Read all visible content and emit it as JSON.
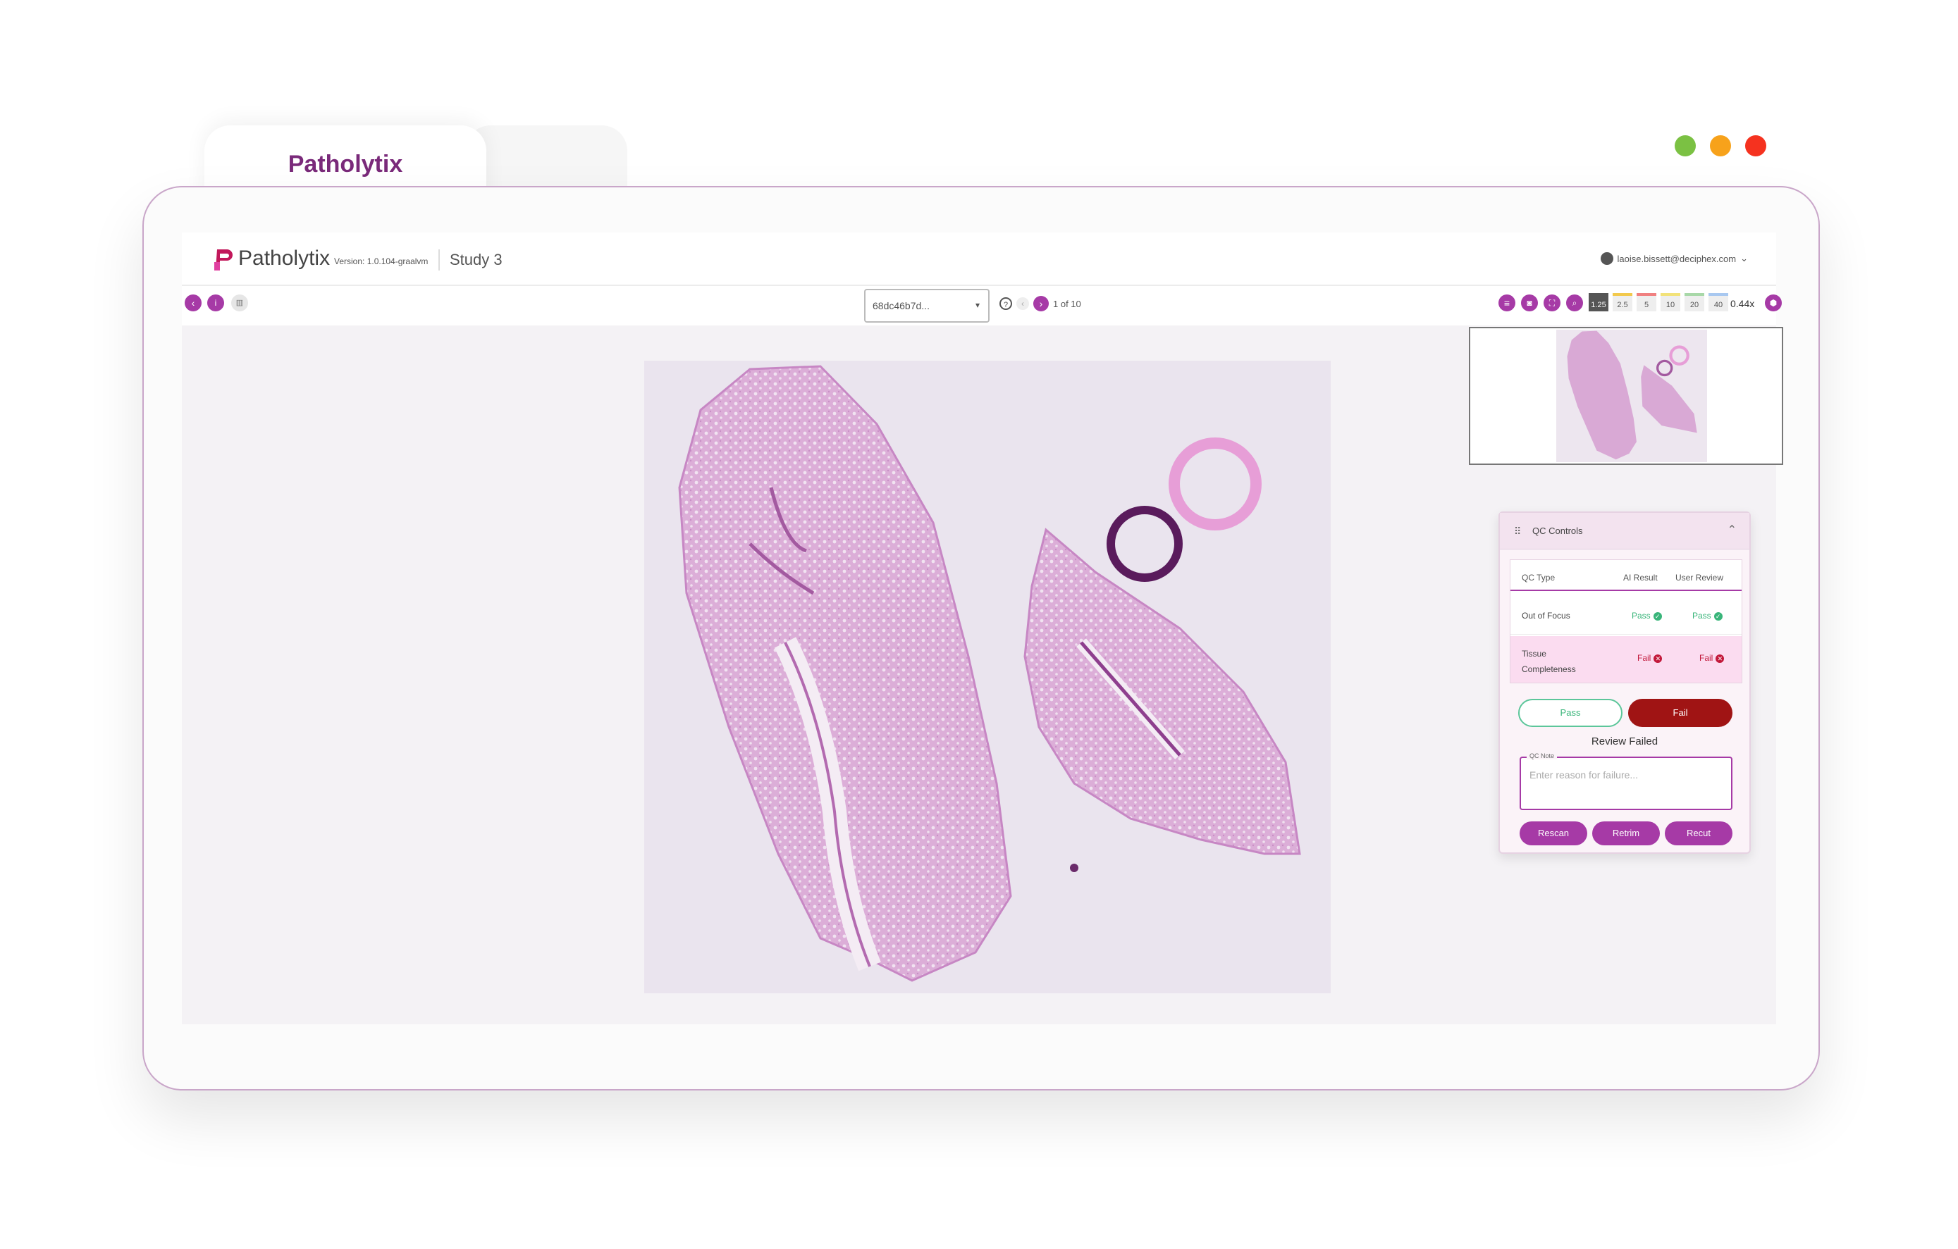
{
  "window": {
    "tab_title": "Patholytix",
    "dots": [
      "#7bc143",
      "#f7a21b",
      "#f5321f"
    ]
  },
  "header": {
    "logo_text": "Patholytix",
    "version": "Version: 1.0.104-graalvm",
    "study": "Study 3",
    "user_email": "laoise.bissett@deciphex.com"
  },
  "toolbar": {
    "slide_select_value": "68dc46b7d...",
    "pager_text": "1 of 10",
    "magnifications": [
      "1.25",
      "2.5",
      "5",
      "10",
      "20",
      "40"
    ],
    "magnification_colors": [
      "#555555",
      "#f2c94c",
      "#f08080",
      "#f2e279",
      "#a8d8a8",
      "#a8c8f0"
    ],
    "active_magnification": "1.25",
    "zoom_value": "0.44x"
  },
  "qc": {
    "title": "QC Controls",
    "columns": [
      "QC Type",
      "AI Result",
      "User Review"
    ],
    "rows": [
      {
        "type": "Out of Focus",
        "ai": "Pass",
        "user": "Pass"
      },
      {
        "type": "Tissue Completeness",
        "ai": "Fail",
        "user": "Fail"
      }
    ],
    "pass_label": "Pass",
    "fail_label": "Fail",
    "review_status": "Review Failed",
    "note_label": "QC Note",
    "note_placeholder": "Enter reason for failure...",
    "actions": [
      "Rescan",
      "Retrim",
      "Recut"
    ]
  }
}
